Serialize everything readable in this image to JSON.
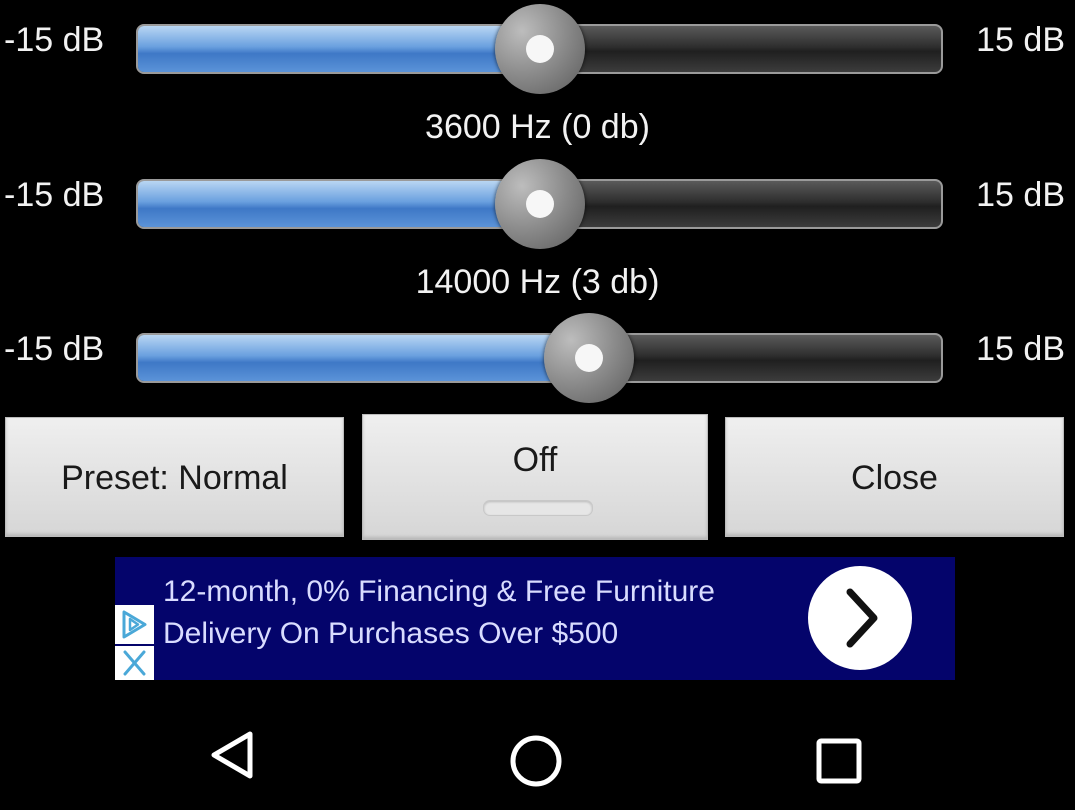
{
  "bands": [
    {
      "label": "",
      "value_db": 0,
      "min_label": "-15 dB",
      "max_label": "15 dB"
    },
    {
      "label": "3600 Hz (0 db)",
      "value_db": 0,
      "min_label": "-15 dB",
      "max_label": "15 dB"
    },
    {
      "label": "14000 Hz (3 db)",
      "value_db": 3,
      "min_label": "-15 dB",
      "max_label": "15 dB"
    }
  ],
  "range_db": [
    -15,
    15
  ],
  "buttons": {
    "preset": "Preset: Normal",
    "toggle": "Off",
    "close": "Close"
  },
  "ad": {
    "line1": "12-month, 0% Financing & Free Furniture",
    "line2": "Delivery On Purchases Over $500",
    "background": "#04046b"
  },
  "colors": {
    "slider_fill": "#5b93d8",
    "track": "#2e2e2e"
  },
  "nav": {
    "icons": [
      "back-icon",
      "home-icon",
      "recents-icon"
    ]
  }
}
